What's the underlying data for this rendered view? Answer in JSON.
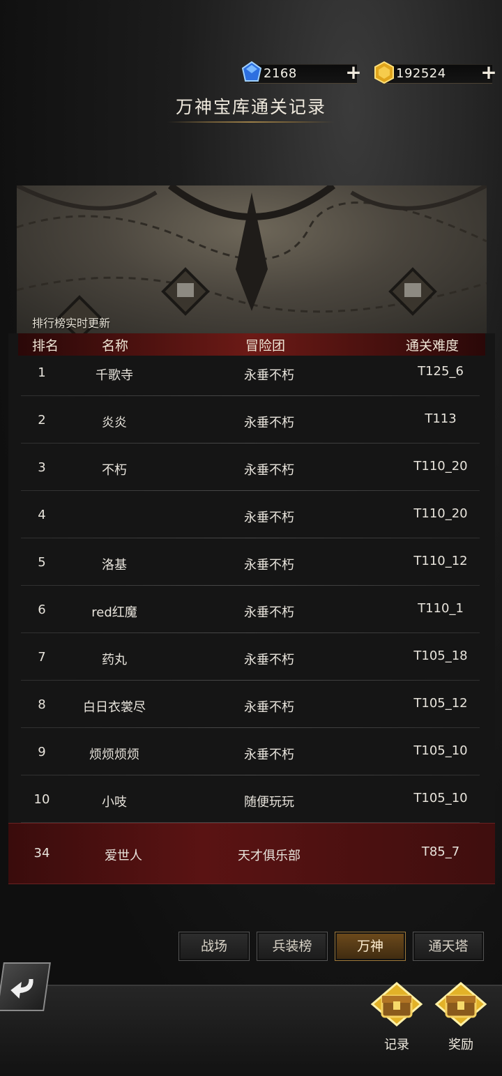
{
  "currency": {
    "blue_gem": {
      "value": "2168",
      "icon": "blue-gem-icon"
    },
    "gold_gem": {
      "value": "192524",
      "icon": "gold-gem-icon"
    },
    "plus_symbol": "+"
  },
  "title": "万神宝库通关记录",
  "banner_note": "排行榜实时更新",
  "table": {
    "headers": {
      "rank": "排名",
      "name": "名称",
      "team": "冒险团",
      "difficulty": "通关难度"
    },
    "rows": [
      {
        "rank": "1",
        "name": "千歌寺",
        "team": "永垂不朽",
        "difficulty": "T125_6"
      },
      {
        "rank": "2",
        "name": "炎炎",
        "team": "永垂不朽",
        "difficulty": "T113"
      },
      {
        "rank": "3",
        "name": "不朽",
        "team": "永垂不朽",
        "difficulty": "T110_20"
      },
      {
        "rank": "4",
        "name": "",
        "team": "永垂不朽",
        "difficulty": "T110_20"
      },
      {
        "rank": "5",
        "name": "洛基",
        "team": "永垂不朽",
        "difficulty": "T110_12"
      },
      {
        "rank": "6",
        "name": "red红魔",
        "team": "永垂不朽",
        "difficulty": "T110_1"
      },
      {
        "rank": "7",
        "name": "药丸",
        "team": "永垂不朽",
        "difficulty": "T105_18"
      },
      {
        "rank": "8",
        "name": "白日衣裳尽",
        "team": "永垂不朽",
        "difficulty": "T105_12"
      },
      {
        "rank": "9",
        "name": "烦烦烦烦",
        "team": "永垂不朽",
        "difficulty": "T105_10"
      },
      {
        "rank": "10",
        "name": "小吱",
        "team": "随便玩玩",
        "difficulty": "T105_10"
      }
    ],
    "me": {
      "rank": "34",
      "name": "爱世人",
      "team": "天才俱乐部",
      "difficulty": "T85_7"
    }
  },
  "tabs": [
    "战场",
    "兵装榜",
    "万神",
    "通天塔"
  ],
  "active_tab": "万神",
  "bottom": {
    "record_label": "记录",
    "reward_label": "奖励"
  }
}
